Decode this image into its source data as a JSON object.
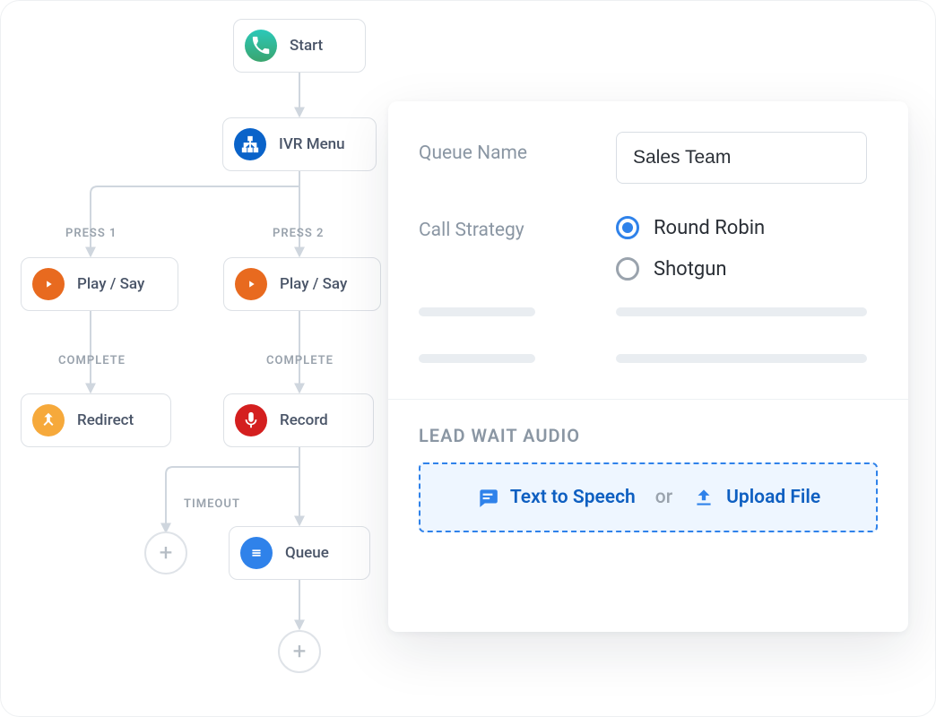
{
  "flow": {
    "nodes": {
      "start": {
        "label": "Start"
      },
      "ivr": {
        "label": "IVR Menu"
      },
      "play1": {
        "label": "Play / Say"
      },
      "play2": {
        "label": "Play / Say"
      },
      "redirect": {
        "label": "Redirect"
      },
      "record": {
        "label": "Record"
      },
      "queue": {
        "label": "Queue"
      }
    },
    "edges": {
      "press1": "PRESS 1",
      "press2": "PRESS 2",
      "complete1": "COMPLETE",
      "complete2": "COMPLETE",
      "timeout": "TIMEOUT"
    }
  },
  "panel": {
    "queue_name_label": "Queue Name",
    "queue_name_value": "Sales Team",
    "call_strategy_label": "Call Strategy",
    "strategy_options": {
      "round_robin": "Round Robin",
      "shotgun": "Shotgun"
    },
    "lead_wait_title": "LEAD WAIT AUDIO",
    "tts_label": "Text to Speech",
    "or_label": "or",
    "upload_label": "Upload File"
  }
}
